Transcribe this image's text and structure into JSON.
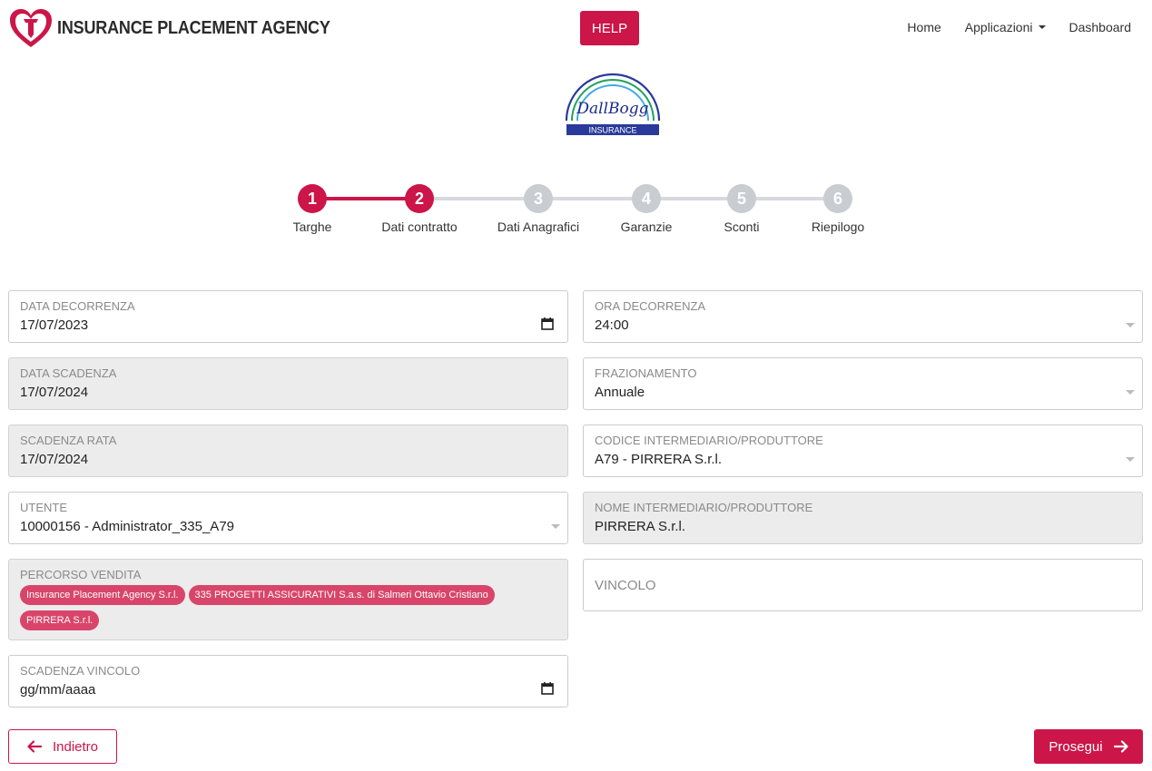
{
  "header": {
    "logo_text": "INSURANCE PLACEMENT AGENCY",
    "help_label": "HELP",
    "nav": {
      "home": "Home",
      "applicazioni": "Applicazioni",
      "dashboard": "Dashboard"
    }
  },
  "brand": {
    "signature": "DallBogg",
    "label": "INSURANCE"
  },
  "stepper": {
    "steps": [
      {
        "number": "1",
        "label": "Targhe",
        "state": "done"
      },
      {
        "number": "2",
        "label": "Dati contratto",
        "state": "current"
      },
      {
        "number": "3",
        "label": "Dati Anagrafici",
        "state": "todo"
      },
      {
        "number": "4",
        "label": "Garanzie",
        "state": "todo"
      },
      {
        "number": "5",
        "label": "Sconti",
        "state": "todo"
      },
      {
        "number": "6",
        "label": "Riepilogo",
        "state": "todo"
      }
    ]
  },
  "form": {
    "data_decorrenza": {
      "label": "DATA DECORRENZA",
      "value": "17/07/2023"
    },
    "ora_decorrenza": {
      "label": "ORA DECORRENZA",
      "value": "24:00"
    },
    "data_scadenza": {
      "label": "DATA SCADENZA",
      "value": "17/07/2024"
    },
    "frazionamento": {
      "label": "FRAZIONAMENTO",
      "value": "Annuale"
    },
    "scadenza_rata": {
      "label": "SCADENZA RATA",
      "value": "17/07/2024"
    },
    "codice_intermediario": {
      "label": "CODICE INTERMEDIARIO/PRODUTTORE",
      "value": "A79 - PIRRERA S.r.l."
    },
    "utente": {
      "label": "UTENTE",
      "value": "10000156 - Administrator_335_A79"
    },
    "nome_intermediario": {
      "label": "NOME INTERMEDIARIO/PRODUTTORE",
      "value": "PIRRERA S.r.l."
    },
    "percorso_vendita": {
      "label": "PERCORSO VENDITA",
      "chips": [
        "Insurance Placement Agency S.r.l.",
        "335 PROGETTI ASSICURATIVI S.a.s. di Salmeri Ottavio Cristiano",
        "PIRRERA S.r.l."
      ]
    },
    "vincolo": {
      "label": "VINCOLO",
      "value": ""
    },
    "scadenza_vincolo": {
      "label": "SCADENZA VINCOLO",
      "value": "gg/mm/aaaa"
    }
  },
  "actions": {
    "back_label": "Indietro",
    "next_label": "Prosegui"
  },
  "colors": {
    "accent": "#cc1548",
    "chip": "#d9456a",
    "step_inactive": "#c9cdd2",
    "disabled_bg": "#ececec"
  }
}
